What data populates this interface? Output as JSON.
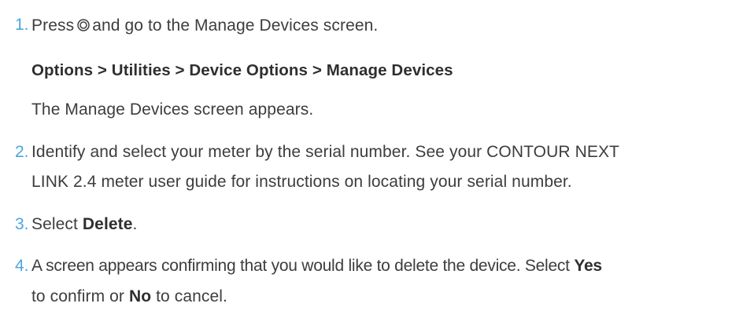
{
  "steps": [
    {
      "number": "1.",
      "text_before_icon": "Press",
      "icon": "home-button-icon",
      "text_after_icon": "and go to the Manage Devices screen.",
      "path": "Options > Utilities > Device Options > Manage Devices",
      "note": "The Manage Devices screen appears."
    },
    {
      "number": "2.",
      "line1": "Identify and select your meter by the serial number. See your CONTOUR NEXT",
      "line2": "LINK 2.4 meter user guide for instructions on locating your serial number."
    },
    {
      "number": "3.",
      "text_before": "Select",
      "bold": "Delete",
      "text_after": "."
    },
    {
      "number": "4.",
      "line1_text": "A screen appears confirming that you would like to delete the device. Select",
      "line1_bold": "Yes",
      "line2_before": "to confirm or",
      "line2_bold": "No",
      "line2_after": "to cancel."
    }
  ],
  "colors": {
    "step_number": "#4da6dc",
    "body_text": "#3d3d3d",
    "bold_text": "#2f2f2f"
  }
}
